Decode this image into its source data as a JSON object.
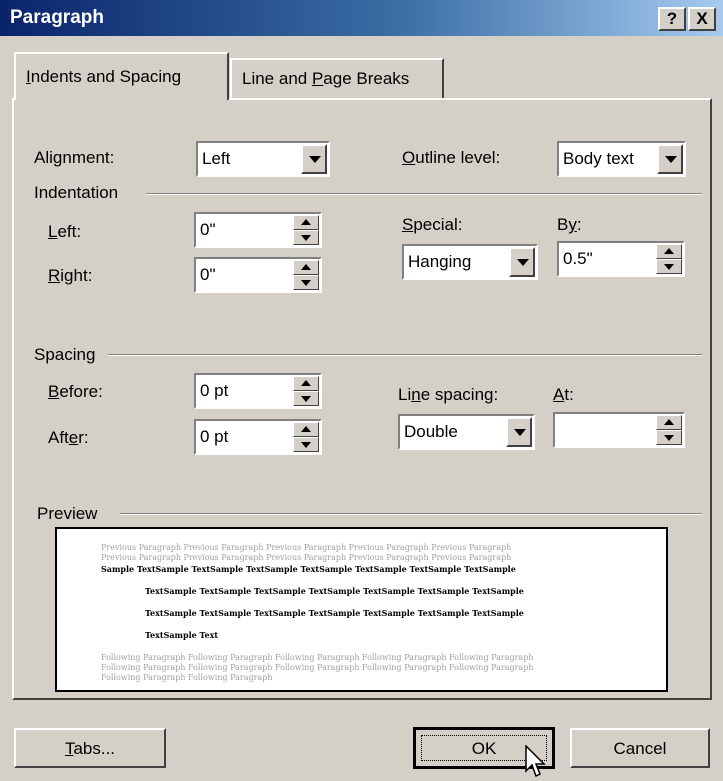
{
  "window": {
    "title": "Paragraph",
    "help_label": "?",
    "close_label": "X"
  },
  "tabs": [
    {
      "label_pre": "",
      "label_key": "I",
      "label_post": "ndents and Spacing"
    },
    {
      "label_pre": "Line and ",
      "label_key": "P",
      "label_post": "age Breaks"
    }
  ],
  "general": {
    "alignment_label_pre": "Ali",
    "alignment_label_key": "g",
    "alignment_label_post": "nment:",
    "alignment_value": "Left",
    "outline_label_pre": "",
    "outline_label_key": "O",
    "outline_label_post": "utline level:",
    "outline_value": "Body text"
  },
  "indentation": {
    "heading": "Indentation",
    "left_label_pre": "",
    "left_label_key": "L",
    "left_label_post": "eft:",
    "left_value": "0\"",
    "right_label_pre": "",
    "right_label_key": "R",
    "right_label_post": "ight:",
    "right_value": "0\"",
    "special_label_pre": "",
    "special_label_key": "S",
    "special_label_post": "pecial:",
    "special_value": "Hanging",
    "by_label_pre": "B",
    "by_label_key": "y",
    "by_label_post": ":",
    "by_value": "0.5\""
  },
  "spacing": {
    "heading": "Spacing",
    "before_label_pre": "",
    "before_label_key": "B",
    "before_label_post": "efore:",
    "before_value": "0 pt",
    "after_label_pre": "Aft",
    "after_label_key": "e",
    "after_label_post": "r:",
    "after_value": "0 pt",
    "line_label_pre": "Li",
    "line_label_key": "n",
    "line_label_post": "e spacing:",
    "line_value": "Double",
    "at_label_pre": "",
    "at_label_key": "A",
    "at_label_post": "t:",
    "at_value": ""
  },
  "preview": {
    "heading": "Preview",
    "previous_lines": [
      "Previous Paragraph Previous Paragraph Previous Paragraph Previous Paragraph Previous Paragraph",
      "Previous Paragraph Previous Paragraph Previous Paragraph Previous Paragraph Previous Paragraph"
    ],
    "sample_lines": [
      "Sample TextSample TextSample TextSample TextSample TextSample TextSample TextSample",
      "TextSample TextSample TextSample TextSample TextSample TextSample TextSample",
      "TextSample TextSample TextSample TextSample TextSample TextSample TextSample",
      "TextSample Text"
    ],
    "following_lines": [
      "Following Paragraph Following Paragraph Following Paragraph Following Paragraph Following Paragraph",
      "Following Paragraph Following Paragraph Following Paragraph Following Paragraph Following Paragraph",
      "Following Paragraph Following Paragraph"
    ]
  },
  "buttons": {
    "tabs_pre": "",
    "tabs_key": "T",
    "tabs_post": "abs...",
    "ok": "OK",
    "cancel": "Cancel"
  }
}
